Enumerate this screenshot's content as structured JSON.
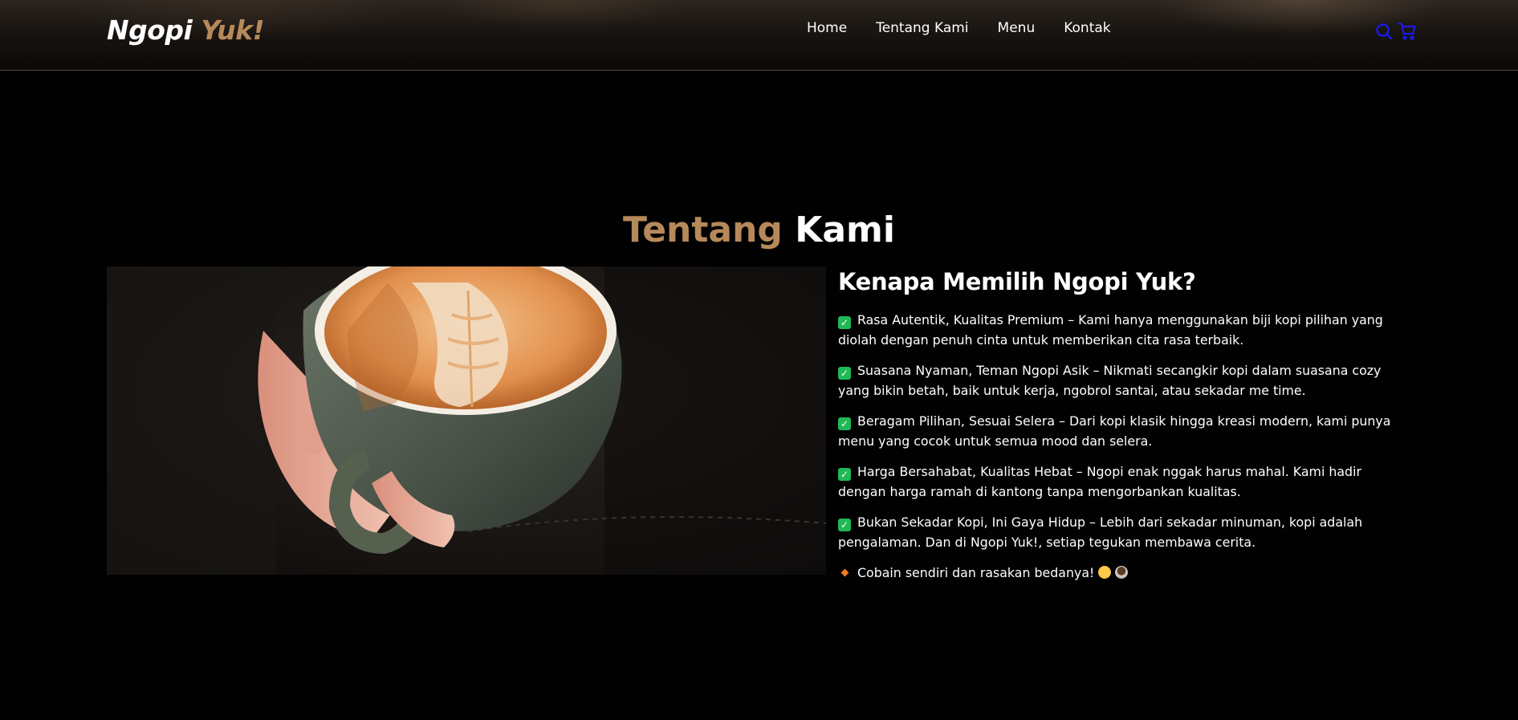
{
  "brand": {
    "first": "Ngopi",
    "second": "Yuk!"
  },
  "nav": {
    "links": [
      "Home",
      "Tentang Kami",
      "Menu",
      "Kontak"
    ],
    "icons": [
      "search-icon",
      "shopping-cart-icon"
    ]
  },
  "about": {
    "title_first": "Tentang",
    "title_second": "Kami",
    "heading": "Kenapa Memilih Ngopi Yuk?",
    "points": [
      "Rasa Autentik, Kualitas Premium – Kami hanya menggunakan biji kopi pilihan yang diolah dengan penuh cinta untuk memberikan cita rasa terbaik.",
      "Suasana Nyaman, Teman Ngopi Asik – Nikmati secangkir kopi dalam suasana cozy yang bikin betah, baik untuk kerja, ngobrol santai, atau sekadar me time.",
      "Beragam Pilihan, Sesuai Selera – Dari kopi klasik hingga kreasi modern, kami punya menu yang cocok untuk semua mood dan selera.",
      "Harga Bersahabat, Kualitas Hebat – Ngopi enak nggak harus mahal. Kami hadir dengan harga ramah di kantong tanpa mengorbankan kualitas.",
      "Bukan Sekadar Kopi, Ini Gaya Hidup – Lebih dari sekadar minuman, kopi adalah pengalaman. Dan di Ngopi Yuk!, setiap tegukan membawa cerita."
    ],
    "closing": "Cobain sendiri dan rasakan bedanya!"
  },
  "colors": {
    "background": "#010101",
    "accent": "#b6895b",
    "text": "#ffffff",
    "icon": "#1a1aff",
    "check": "#1fb955"
  }
}
